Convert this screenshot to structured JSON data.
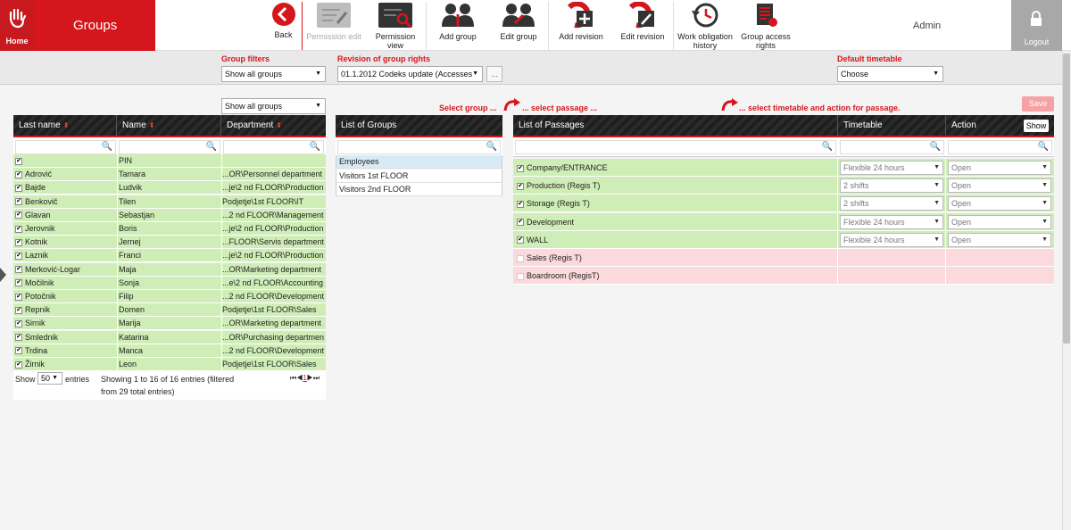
{
  "header": {
    "home_label": "Home",
    "title": "Groups",
    "admin_label": "Admin",
    "logout_label": "Logout",
    "toolbar": [
      {
        "label": "Back",
        "icon": "back-icon",
        "disabled": false
      },
      {
        "label": "Permission edit",
        "icon": "edit-doc-icon",
        "disabled": true
      },
      {
        "label": "Permission view",
        "icon": "view-doc-icon",
        "disabled": false
      },
      {
        "label": "Add group",
        "icon": "add-group-icon",
        "disabled": false
      },
      {
        "label": "Edit group",
        "icon": "edit-group-icon",
        "disabled": false
      },
      {
        "label": "Add revision",
        "icon": "add-revision-icon",
        "disabled": false
      },
      {
        "label": "Edit revision",
        "icon": "edit-revision-icon",
        "disabled": false
      },
      {
        "label": "Work obligation history",
        "icon": "clock-history-icon",
        "disabled": false
      },
      {
        "label": "Group access rights",
        "icon": "access-rights-icon",
        "disabled": false
      }
    ]
  },
  "filters": {
    "group_filters_label": "Group filters",
    "group_filters_value": "Show all groups",
    "revision_label": "Revision of group rights",
    "revision_value": "01.1.2012 Codeks update (Accesses",
    "revision_more": "...",
    "default_timetable_label": "Default timetable",
    "default_timetable_value": "Choose"
  },
  "hints": {
    "select_group": "Select group ...",
    "select_passage": "... select passage ...",
    "select_timetable": "... select timetable and action for passage."
  },
  "save_label": "Save",
  "people_table": {
    "filter_value": "Show all groups",
    "columns": [
      "Last name",
      "Name",
      "Department"
    ],
    "rows": [
      {
        "last": "",
        "first": "PIN",
        "dept": ""
      },
      {
        "last": "Adrović",
        "first": "Tamara",
        "dept": "...OR\\Personnel department"
      },
      {
        "last": "Bajde",
        "first": "Ludvik",
        "dept": "...je\\2 nd FLOOR\\Production"
      },
      {
        "last": "Benkovič",
        "first": "Tilen",
        "dept": "Podjetje\\1st FLOOR\\IT"
      },
      {
        "last": "Glavan",
        "first": "Sebastjan",
        "dept": "...2 nd FLOOR\\Management"
      },
      {
        "last": "Jerovnik",
        "first": "Boris",
        "dept": "...je\\2 nd FLOOR\\Production"
      },
      {
        "last": "Kotnik",
        "first": "Jernej",
        "dept": "...FLOOR\\Servis department"
      },
      {
        "last": "Laznik",
        "first": "Franci",
        "dept": "...je\\2 nd FLOOR\\Production"
      },
      {
        "last": "Merković-Logar",
        "first": "Maja",
        "dept": "...OR\\Marketing department"
      },
      {
        "last": "Močilnik",
        "first": "Sonja",
        "dept": "...e\\2 nd FLOOR\\Accounting"
      },
      {
        "last": "Potočnik",
        "first": "Filip",
        "dept": "...2 nd FLOOR\\Development"
      },
      {
        "last": "Repnik",
        "first": "Domen",
        "dept": "Podjetje\\1st FLOOR\\Sales"
      },
      {
        "last": "Sirnik",
        "first": "Marija",
        "dept": "...OR\\Marketing department"
      },
      {
        "last": "Smlednik",
        "first": "Katarina",
        "dept": "...OR\\Purchasing department"
      },
      {
        "last": "Trdina",
        "first": "Manca",
        "dept": "...2 nd FLOOR\\Development"
      },
      {
        "last": "Žirnik",
        "first": "Leon",
        "dept": "Podjetje\\1st FLOOR\\Sales"
      }
    ],
    "show_label": "Show",
    "page_size": "50",
    "entries_label": "entries",
    "info_line1": "Showing 1 to 16 of 16 entries (filtered",
    "info_line2": "from 29 total entries)",
    "page_current": "1"
  },
  "groups_table": {
    "header": "List of Groups",
    "rows": [
      "Employees",
      "Visitors 1st FLOOR",
      "Visitors 2nd FLOOR"
    ]
  },
  "passages_table": {
    "columns": [
      "List of Passages",
      "Timetable",
      "Action"
    ],
    "show_button": "Show",
    "rows": [
      {
        "name": "Company/ENTRANCE",
        "timetable": "Flexible 24 hours",
        "action": "Open",
        "checked": true
      },
      {
        "name": "Production (Regis T)",
        "timetable": "2 shifts",
        "action": "Open",
        "checked": true
      },
      {
        "name": "Storage (Regis T)",
        "timetable": "2 shifts",
        "action": "Open",
        "checked": true
      },
      {
        "name": "Development",
        "timetable": "Flexible 24 hours",
        "action": "Open",
        "checked": true
      },
      {
        "name": "WALL",
        "timetable": "Flexible 24 hours",
        "action": "Open",
        "checked": true
      },
      {
        "name": "Sales (Regis T)",
        "timetable": "",
        "action": "",
        "checked": false
      },
      {
        "name": "Boardroom (RegisT)",
        "timetable": "",
        "action": "",
        "checked": false
      }
    ]
  },
  "colors": {
    "brand_red": "#d5161c",
    "row_green": "#cfedb6",
    "row_pink": "#fbd9dc"
  }
}
